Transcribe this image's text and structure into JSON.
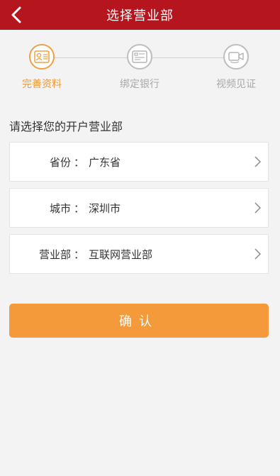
{
  "header": {
    "title": "选择营业部"
  },
  "steps": [
    {
      "label": "完善资料",
      "active": true,
      "icon": "id-card-icon"
    },
    {
      "label": "绑定银行",
      "active": false,
      "icon": "bank-card-icon"
    },
    {
      "label": "视频见证",
      "active": false,
      "icon": "video-icon"
    }
  ],
  "section": {
    "title": "请选择您的开户营业部"
  },
  "fields": {
    "province": {
      "label": "省份",
      "value": "广东省"
    },
    "city": {
      "label": "城市",
      "value": "深圳市"
    },
    "branch": {
      "label": "营业部",
      "value": "互联网营业部"
    }
  },
  "colon": "：",
  "confirm": {
    "label": "确认"
  },
  "colors": {
    "header_bg": "#b5151d",
    "accent_orange": "#f49a3a",
    "inactive_gray": "#a9a9a9"
  }
}
